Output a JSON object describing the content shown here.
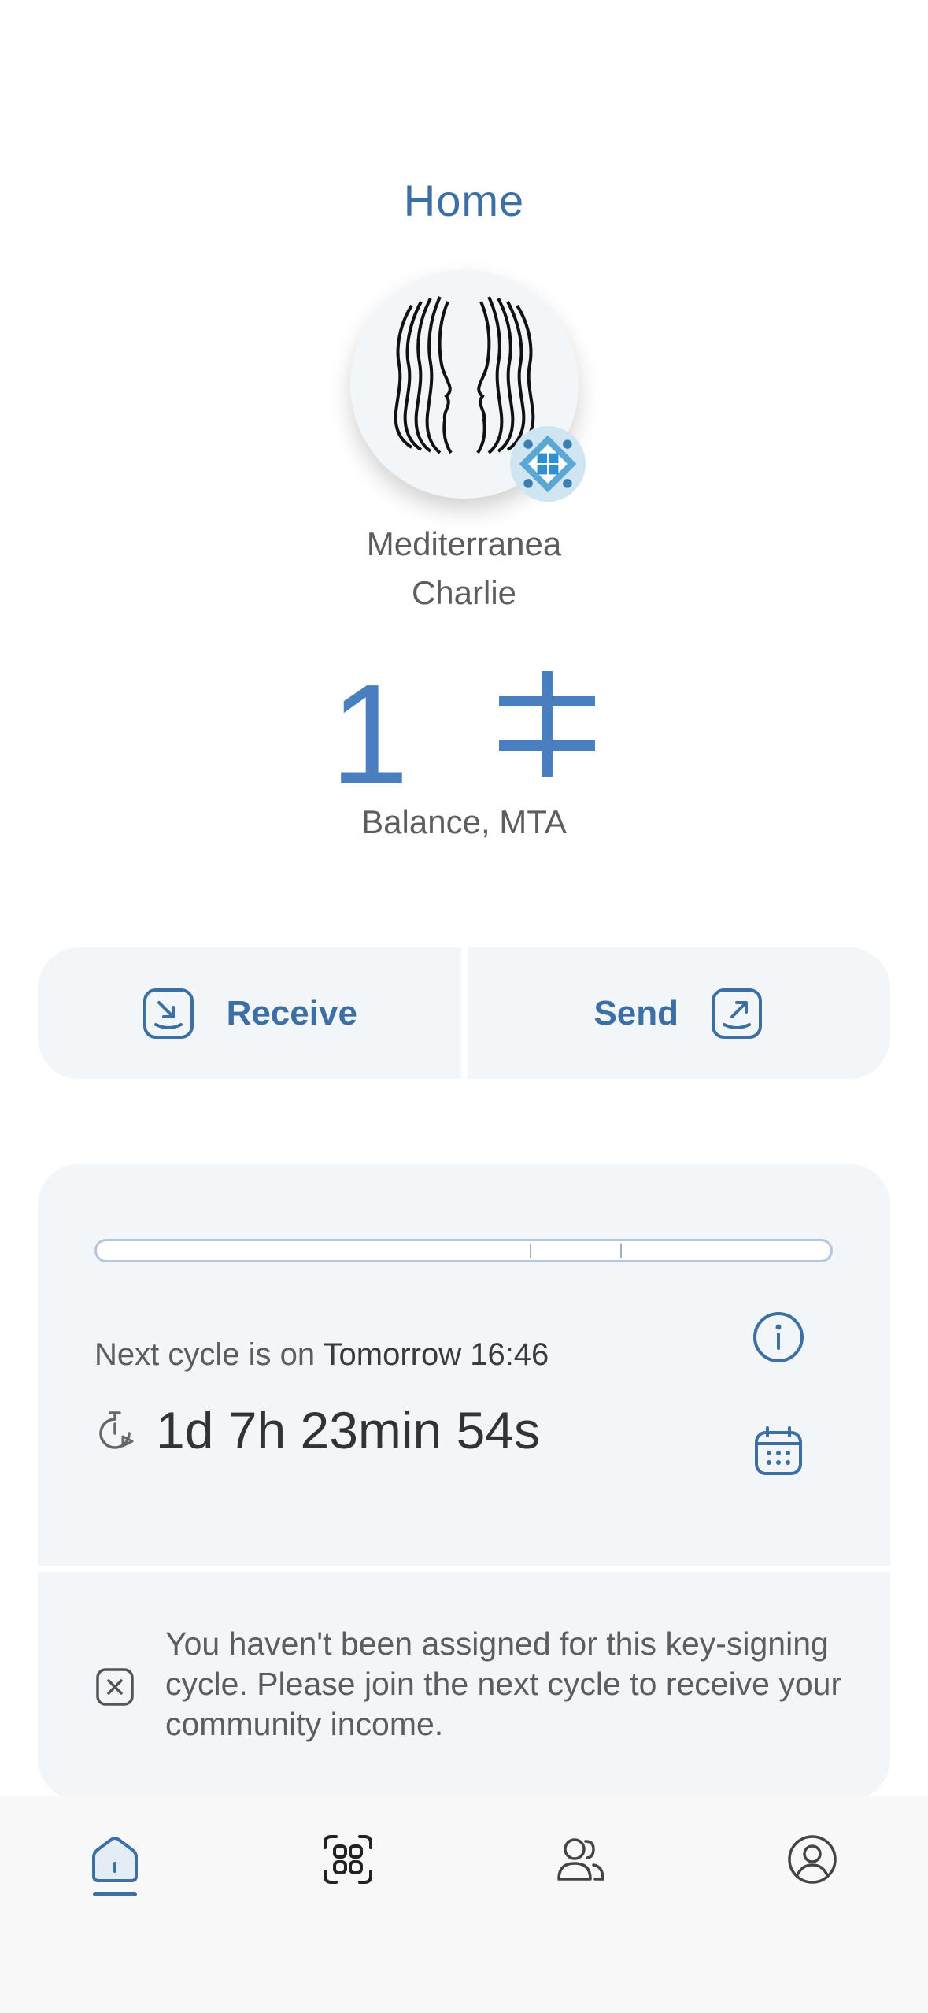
{
  "header": {
    "title": "Home"
  },
  "community": {
    "name_line1": "Mediterranea",
    "name_line2": "Charlie"
  },
  "balance": {
    "amount": "1",
    "currency_symbol": "ⵜ",
    "label": "Balance, MTA"
  },
  "actions": {
    "receive_label": "Receive",
    "send_label": "Send"
  },
  "cycle": {
    "next_prefix": "Next cycle is on",
    "next_value": "Tomorrow 16:46",
    "countdown": "1d 7h 23min 54s"
  },
  "notice": {
    "text": "You haven't been assigned for this key-signing cycle. Please join the next cycle to receive your community income."
  },
  "nav": {
    "active": "home",
    "items": [
      "home-icon",
      "scan-icon",
      "contacts-icon",
      "profile-icon"
    ]
  },
  "colors": {
    "accent": "#3c6fa3",
    "balance": "#4a7fbf",
    "card_bg": "#f2f6f8"
  }
}
